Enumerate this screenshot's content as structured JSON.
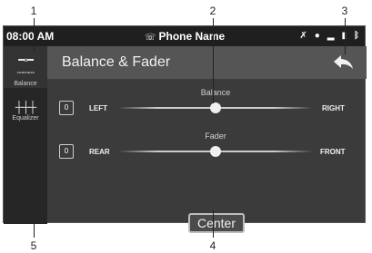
{
  "callouts": [
    "1",
    "2",
    "3",
    "4",
    "5"
  ],
  "status": {
    "time": "08:00 AM",
    "phone_name": "Phone Name",
    "icons": [
      "bluetooth-muted-icon",
      "ta-icon",
      "signal-icon",
      "battery-icon",
      "bluetooth-icon"
    ]
  },
  "sidebar": {
    "items": [
      {
        "label": "Balance",
        "icon": "balance-icon",
        "active": true
      },
      {
        "label": "Equalizer",
        "icon": "equalizer-icon",
        "active": false
      }
    ]
  },
  "header": {
    "title": "Balance & Fader"
  },
  "balance": {
    "caption": "Balance",
    "value": "0",
    "left_label": "LEFT",
    "right_label": "RIGHT",
    "position": 0.5
  },
  "fader": {
    "caption": "Fader",
    "value": "0",
    "left_label": "REAR",
    "right_label": "FRONT",
    "position": 0.5
  },
  "center_button": {
    "label": "Center"
  },
  "colors": {
    "screen_bg": "#3b3b3b",
    "header_bg": "#555555",
    "sidebar_bg": "#262626",
    "statusbar_bg": "#1f1f1f"
  }
}
